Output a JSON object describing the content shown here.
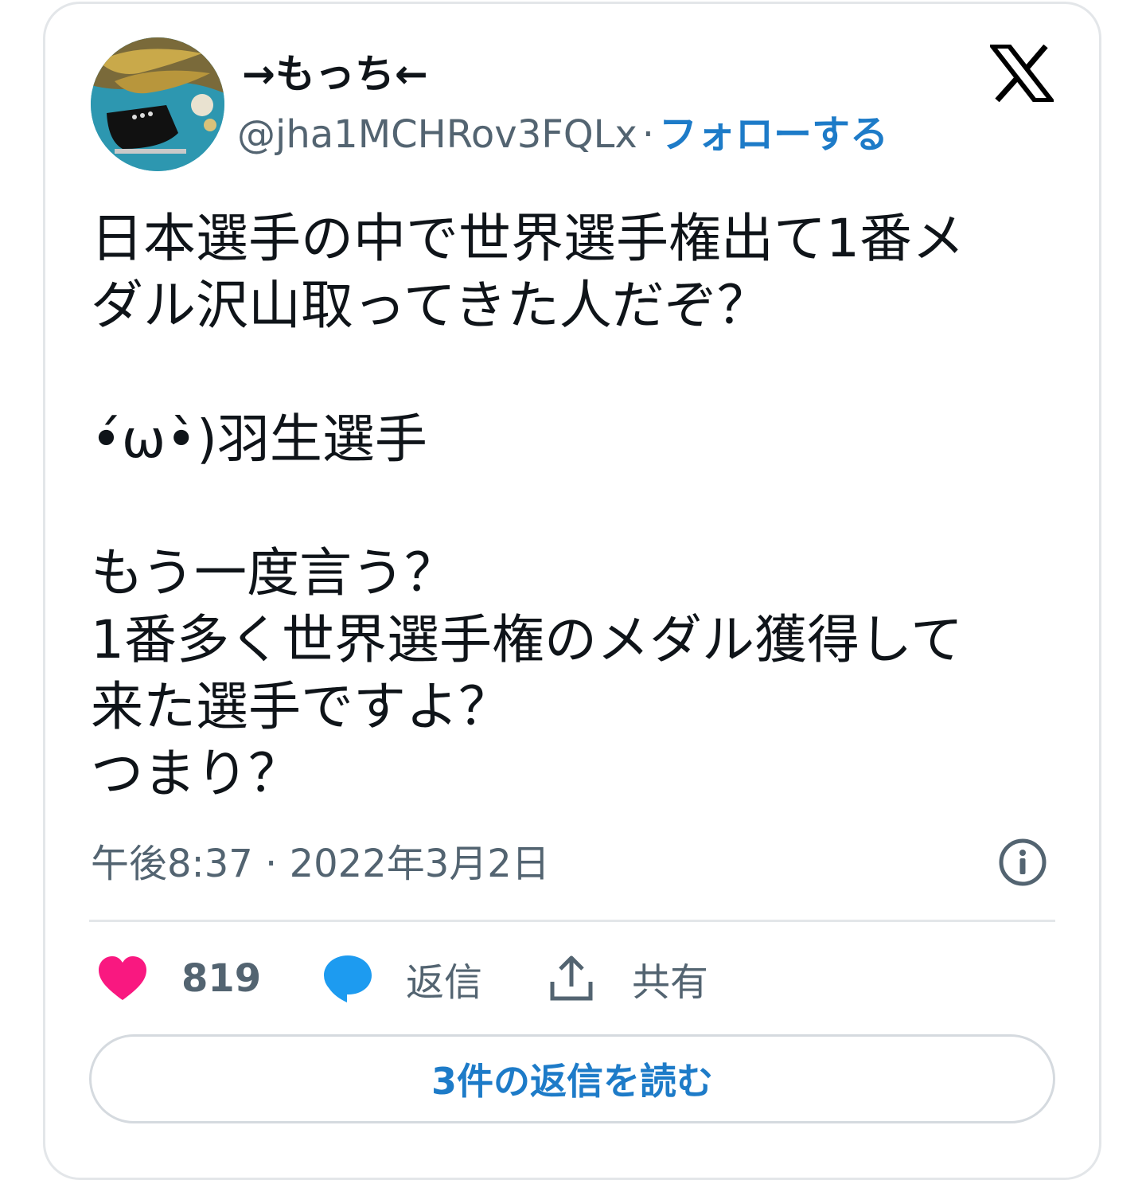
{
  "author": {
    "display_name": "→もっち←",
    "handle": "@jha1MCHRov3FQLx",
    "separator": "·",
    "follow_label": "フォローする"
  },
  "tweet": {
    "text": "日本選手の中で世界選手権出て1番メ\nダル沢山取ってきた人だぞ？\n\n•́ω•̀)羽生選手\n\nもう一度言う？\n1番多く世界選手権のメダル獲得して\n来た選手ですよ？\nつまり？",
    "timestamp": "午後8:37 · 2022年3月2日"
  },
  "actions": {
    "like_count": "819",
    "reply_label": "返信",
    "share_label": "共有"
  },
  "read_replies_label": "3件の返信を読む",
  "icons": {
    "logo": "x-logo-icon",
    "info": "info-icon",
    "like": "heart-icon",
    "reply": "speech-bubble-icon",
    "share": "share-upload-icon"
  },
  "colors": {
    "like": "#f91880",
    "reply": "#1d9bf0",
    "link": "#1d7bc8",
    "secondary_text": "#536471",
    "primary_text": "#0f1419"
  }
}
